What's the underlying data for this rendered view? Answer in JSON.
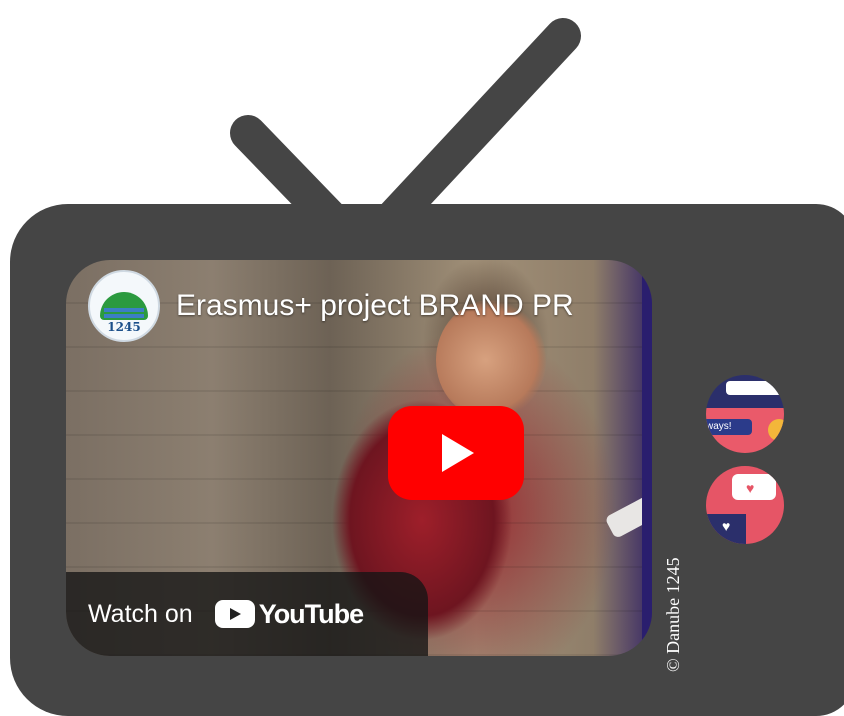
{
  "video": {
    "title": "Erasmus+ project BRAND PR",
    "channel_logo_text": "1245",
    "watch_on_label": "Watch on",
    "platform_label": "YouTube",
    "play_icon": "play-icon"
  },
  "credit": {
    "text": "© Danube 1245"
  },
  "knobs": {
    "top_snippet": "ways!"
  },
  "colors": {
    "tv_body": "#454545",
    "play_button": "#ff0000",
    "knob_pink": "#e65566",
    "knob_navy": "#2b2f6b"
  }
}
